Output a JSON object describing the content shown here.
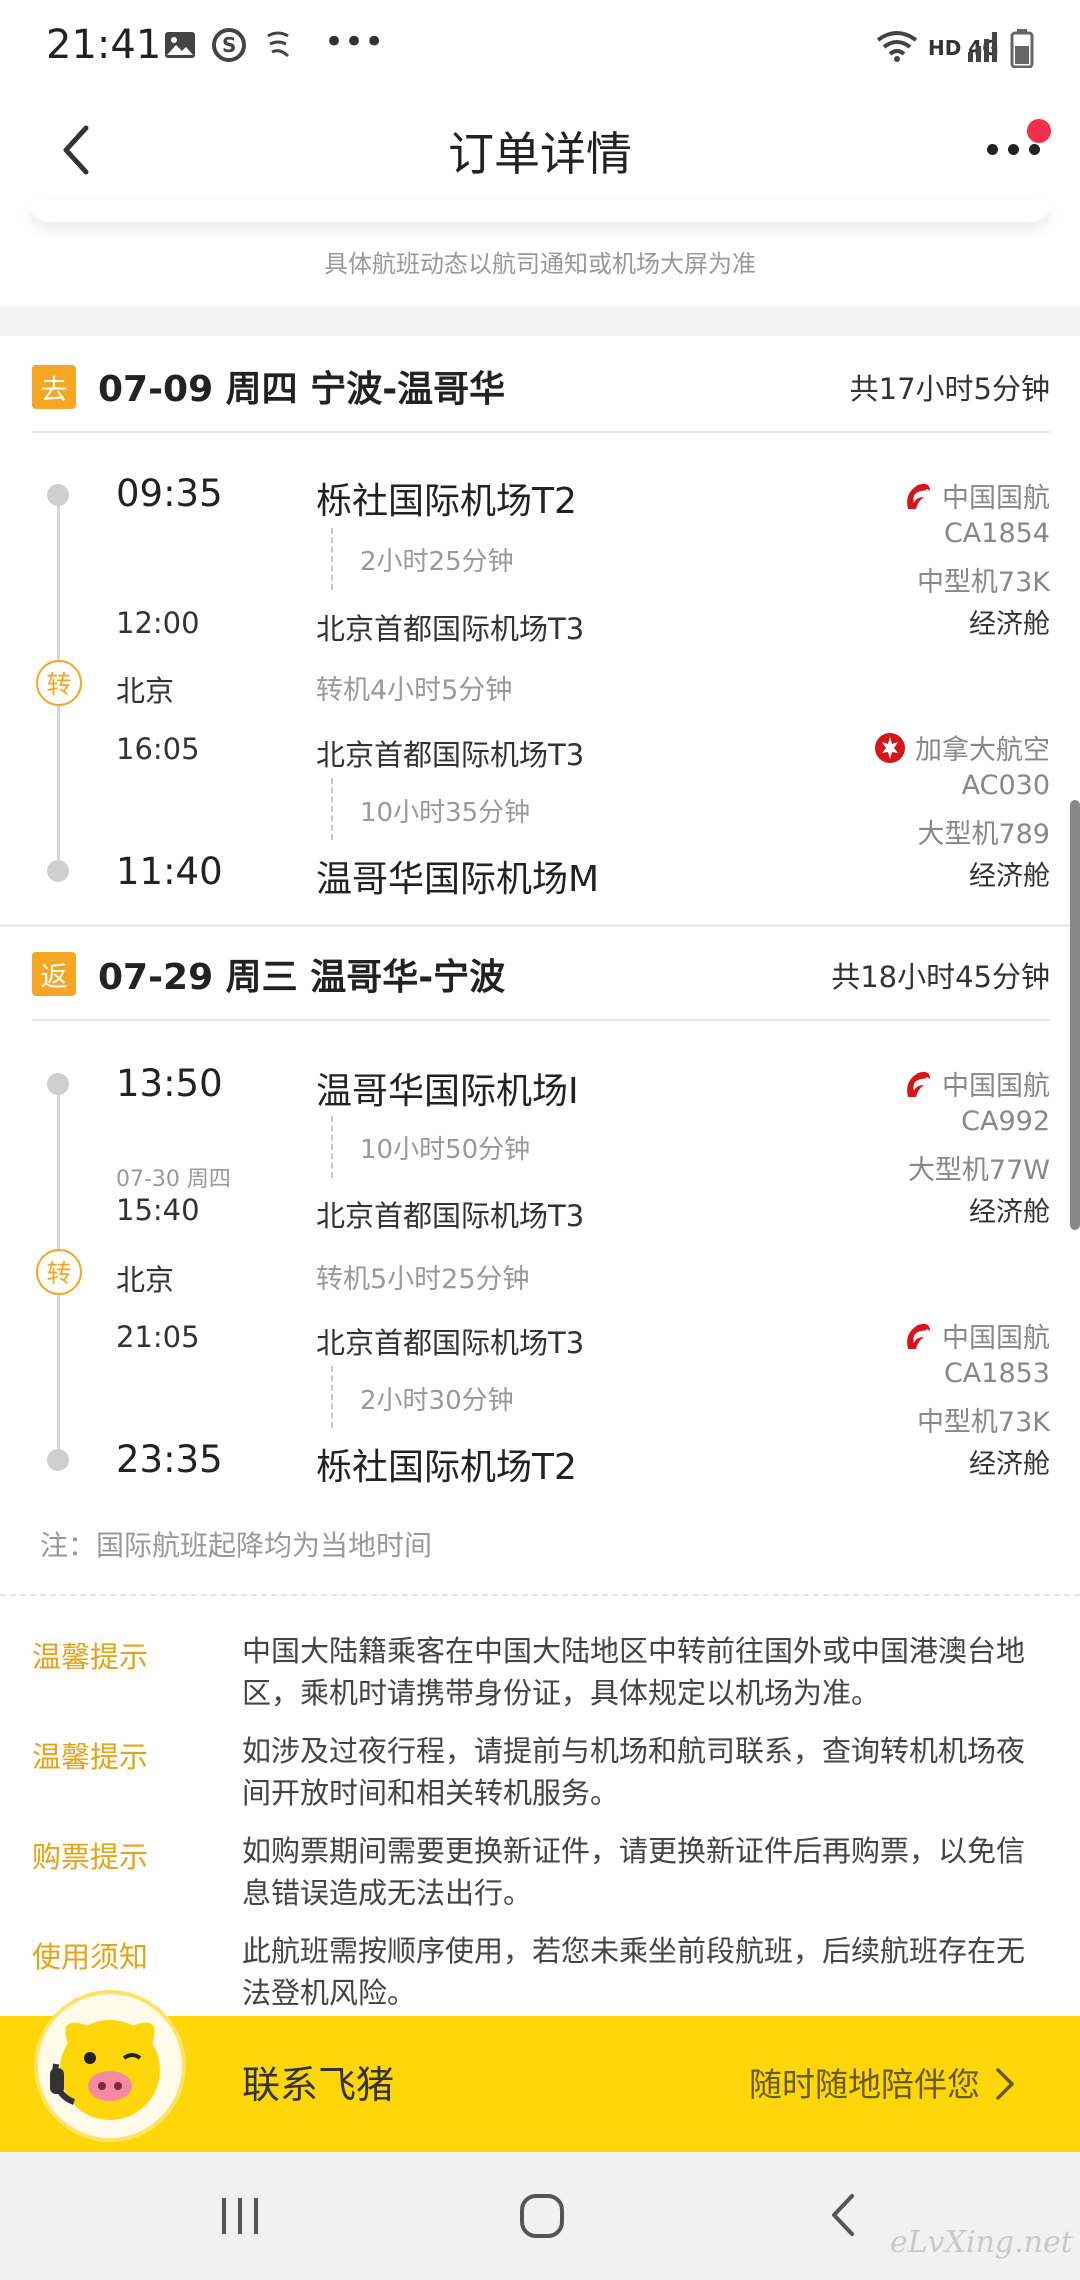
{
  "status_bar": {
    "time": "21:41",
    "network": "HD 4G"
  },
  "header": {
    "title": "订单详情"
  },
  "notice": "具体航班动态以航司通知或机场大屏为准",
  "outbound": {
    "tag": "去",
    "title": "07-09 周四 宁波-温哥华",
    "total": "共17小时5分钟",
    "seg1": {
      "dep_time": "09:35",
      "dep_airport": "栎社国际机场T2",
      "duration": "2小时25分钟",
      "arr_time": "12:00",
      "arr_airport": "北京首都国际机场T3",
      "airline": "中国国航",
      "flight": "CA1854",
      "aircraft": "中型机73K",
      "cabin": "经济舱"
    },
    "transfer": {
      "icon_label": "转",
      "city": "北京",
      "text": "转机4小时5分钟"
    },
    "seg2": {
      "dep_time": "16:05",
      "dep_airport": "北京首都国际机场T3",
      "duration": "10小时35分钟",
      "arr_time": "11:40",
      "arr_airport": "温哥华国际机场M",
      "airline": "加拿大航空",
      "flight": "AC030",
      "aircraft": "大型机789",
      "cabin": "经济舱"
    }
  },
  "return": {
    "tag": "返",
    "title": "07-29 周三 温哥华-宁波",
    "total": "共18小时45分钟",
    "seg1": {
      "dep_time": "13:50",
      "dep_airport": "温哥华国际机场I",
      "duration": "10小时50分钟",
      "arr_date": "07-30 周四",
      "arr_time": "15:40",
      "arr_airport": "北京首都国际机场T3",
      "airline": "中国国航",
      "flight": "CA992",
      "aircraft": "大型机77W",
      "cabin": "经济舱"
    },
    "transfer": {
      "icon_label": "转",
      "city": "北京",
      "text": "转机5小时25分钟"
    },
    "seg2": {
      "dep_time": "21:05",
      "dep_airport": "北京首都国际机场T3",
      "duration": "2小时30分钟",
      "arr_time": "23:35",
      "arr_airport": "栎社国际机场T2",
      "airline": "中国国航",
      "flight": "CA1853",
      "aircraft": "中型机73K",
      "cabin": "经济舱"
    }
  },
  "local_time_note": "注：国际航班起降均为当地时间",
  "tips": [
    {
      "label": "温馨提示",
      "text": "中国大陆籍乘客在中国大陆地区中转前往国外或中国港澳台地区，乘机时请携带身份证，具体规定以机场为准。"
    },
    {
      "label": "温馨提示",
      "text": "如涉及过夜行程，请提前与机场和航司联系，查询转机机场夜间开放时间和相关转机服务。"
    },
    {
      "label": "购票提示",
      "text": "如购票期间需要更换新证件，请更换新证件后再购票，以免信息错误造成无法出行。"
    },
    {
      "label": "使用须知",
      "text": "此航班需按顺序使用，若您未乘坐前段航班，后续航班存在无法登机风险。"
    }
  ],
  "contact": {
    "title": "联系飞猪",
    "subtitle": "随时随地陪伴您"
  },
  "watermark": "eLvXing.net",
  "colors": {
    "accent": "#f5a623",
    "air_china_red": "#d7141a",
    "contact_bar": "#ffd60a"
  }
}
